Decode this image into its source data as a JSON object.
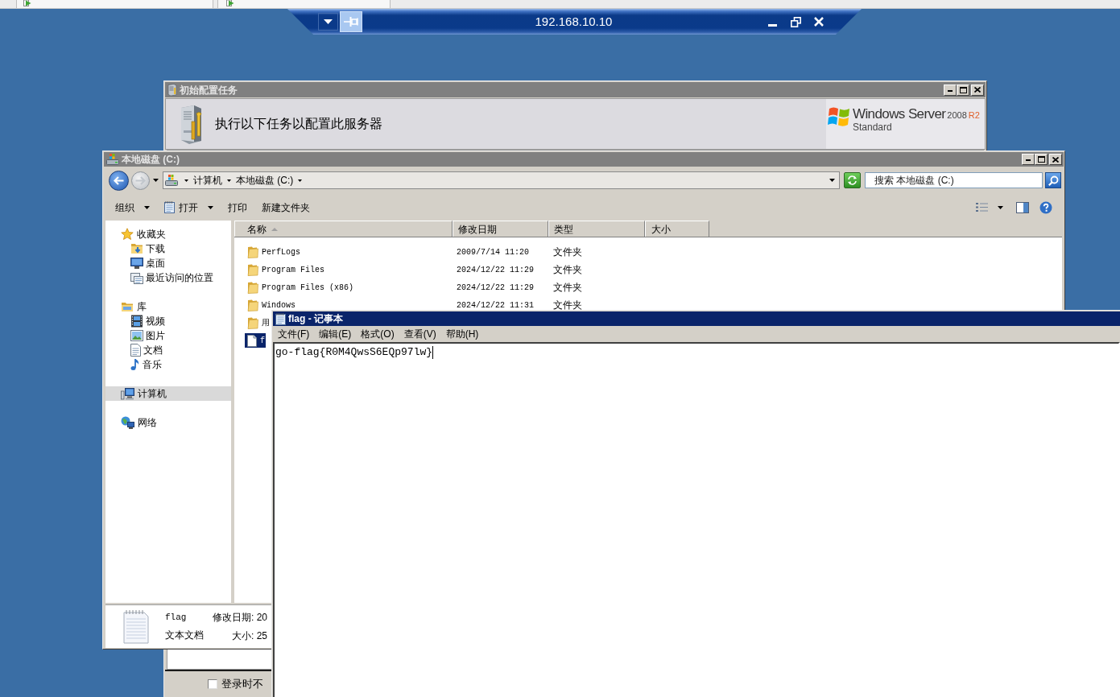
{
  "connection_bar": {
    "title": "192.168.10.10"
  },
  "config_window": {
    "title": "初始配置任务",
    "active": false,
    "heading": "执行以下任务以配置此服务器",
    "logo": {
      "product": "Windows Server",
      "version": "2008",
      "release": "R2",
      "edition": "Standard"
    },
    "startup_option": {
      "label": "登录时不",
      "checked": false
    }
  },
  "explorer": {
    "title": "本地磁盘 (C:)",
    "active": false,
    "nav_buttons": [
      {
        "kind": "back",
        "disabled": false
      },
      {
        "kind": "forward",
        "disabled": true
      }
    ],
    "address": [
      "计算机",
      "本地磁盘 (C:)"
    ],
    "search": {
      "placeholder": "搜索 本地磁盘 (C:)"
    },
    "toolbar": [
      {
        "label": "组织",
        "dropdown": true
      },
      {
        "label": "打开",
        "dropdown": true
      },
      {
        "label": "打印",
        "dropdown": false
      },
      {
        "label": "新建文件夹",
        "dropdown": false
      }
    ],
    "navigation": [
      {
        "label": "收藏夹",
        "selected": false,
        "children": [
          {
            "label": "下载",
            "selected": false
          },
          {
            "label": "桌面",
            "selected": false
          },
          {
            "label": "最近访问的位置",
            "selected": false
          }
        ]
      },
      {
        "label": "库",
        "selected": false,
        "children": [
          {
            "label": "视频",
            "selected": false
          },
          {
            "label": "图片",
            "selected": false
          },
          {
            "label": "文档",
            "selected": false
          },
          {
            "label": "音乐",
            "selected": false
          }
        ]
      },
      {
        "label": "计算机",
        "selected": true
      },
      {
        "label": "网络",
        "selected": false
      }
    ],
    "columns": [
      {
        "label": "名称",
        "sorted": true
      },
      {
        "label": "修改日期",
        "sorted": false
      },
      {
        "label": "类型",
        "sorted": false
      },
      {
        "label": "大小",
        "sorted": false
      }
    ],
    "rows": [
      {
        "kind": "folder",
        "name": "PerfLogs",
        "modified": "2009/7/14 11:20",
        "type": "文件夹",
        "selected": false
      },
      {
        "kind": "folder",
        "name": "Program Files",
        "modified": "2024/12/22 11:29",
        "type": "文件夹",
        "selected": false
      },
      {
        "kind": "folder",
        "name": "Program Files (x86)",
        "modified": "2024/12/22 11:29",
        "type": "文件夹",
        "selected": false
      },
      {
        "kind": "folder",
        "name": "Windows",
        "modified": "2024/12/22 11:31",
        "type": "文件夹",
        "selected": false
      },
      {
        "kind": "folder",
        "name": "用",
        "selected": false
      },
      {
        "kind": "file",
        "name": "f",
        "selected": true
      }
    ],
    "details": {
      "name": "flag",
      "type": "文本文档",
      "modified": "修改日期: 20",
      "size": "大小: 25"
    }
  },
  "notepad": {
    "title": "flag - 记事本",
    "active": true,
    "menu": [
      "文件(F)",
      "编辑(E)",
      "格式(O)",
      "查看(V)",
      "帮助(H)"
    ],
    "text": "go-flag{R0M4QwsS6EQp97lw}"
  }
}
